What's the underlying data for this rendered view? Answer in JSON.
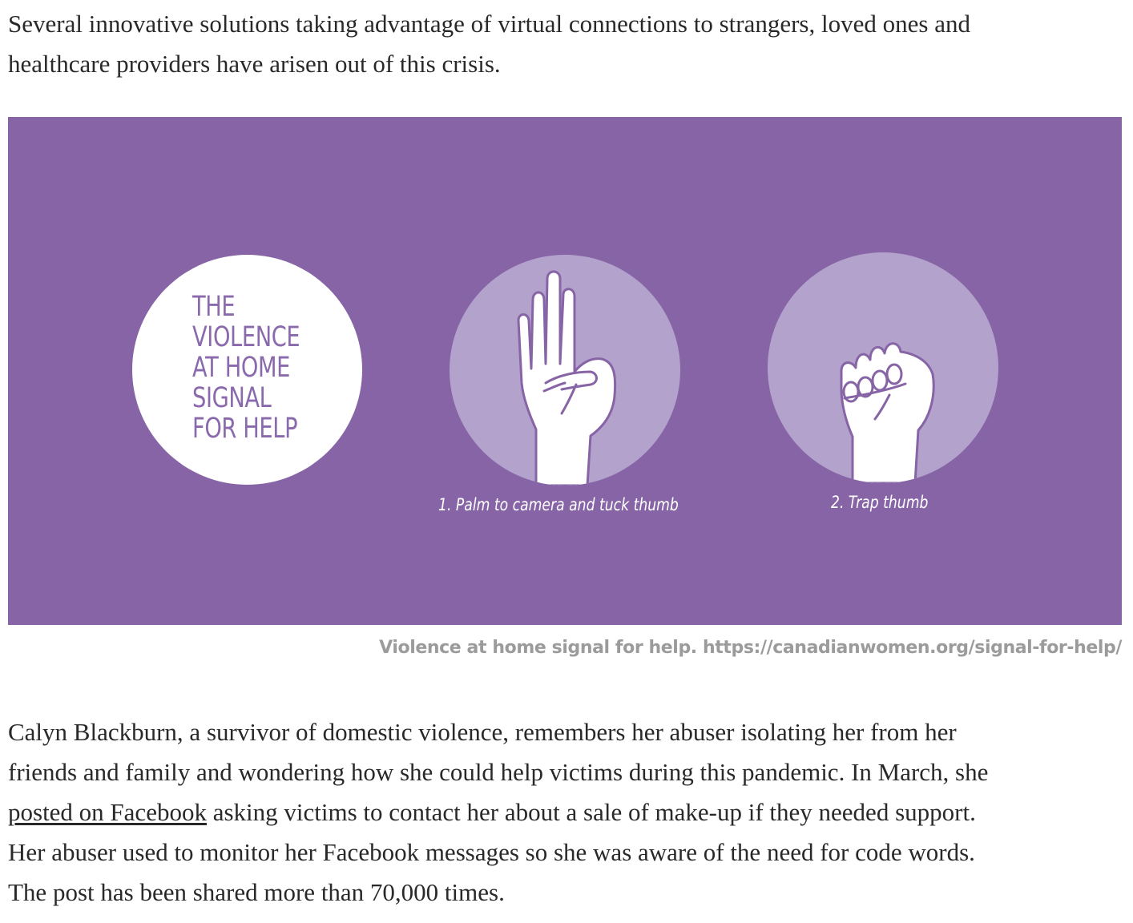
{
  "intro": {
    "lines": [
      "Several innovative solutions taking advantage of virtual connections to strangers, loved ones and",
      "healthcare providers have arisen out of this crisis."
    ]
  },
  "figure": {
    "background_color": "#8664a6",
    "title_lines": [
      "THE",
      "VIOLENCE",
      "AT HOME",
      "SIGNAL",
      "FOR HELP"
    ],
    "step1_label": "1. Palm to camera and tuck thumb",
    "step2_label": "2. Trap thumb",
    "step1_icon": "open-palm-thumb-tucked-icon",
    "step2_icon": "fist-trapped-thumb-icon"
  },
  "caption": "Violence at home signal for help. https://canadianwomen.org/signal-for-help/",
  "story": {
    "line1": "Calyn Blackburn, a survivor of domestic violence, remembers her abuser isolating her from her",
    "line2": "friends and family and wondering how she could help victims during this pandemic. In March, she",
    "link_text": "posted on Facebook",
    "line3_rest": " asking victims to contact her about a sale of make-up if they needed support.",
    "line4": "Her abuser used to monitor her Facebook messages so she was aware of the need for code words.",
    "line5": "The post has been shared more than 70,000 times."
  }
}
